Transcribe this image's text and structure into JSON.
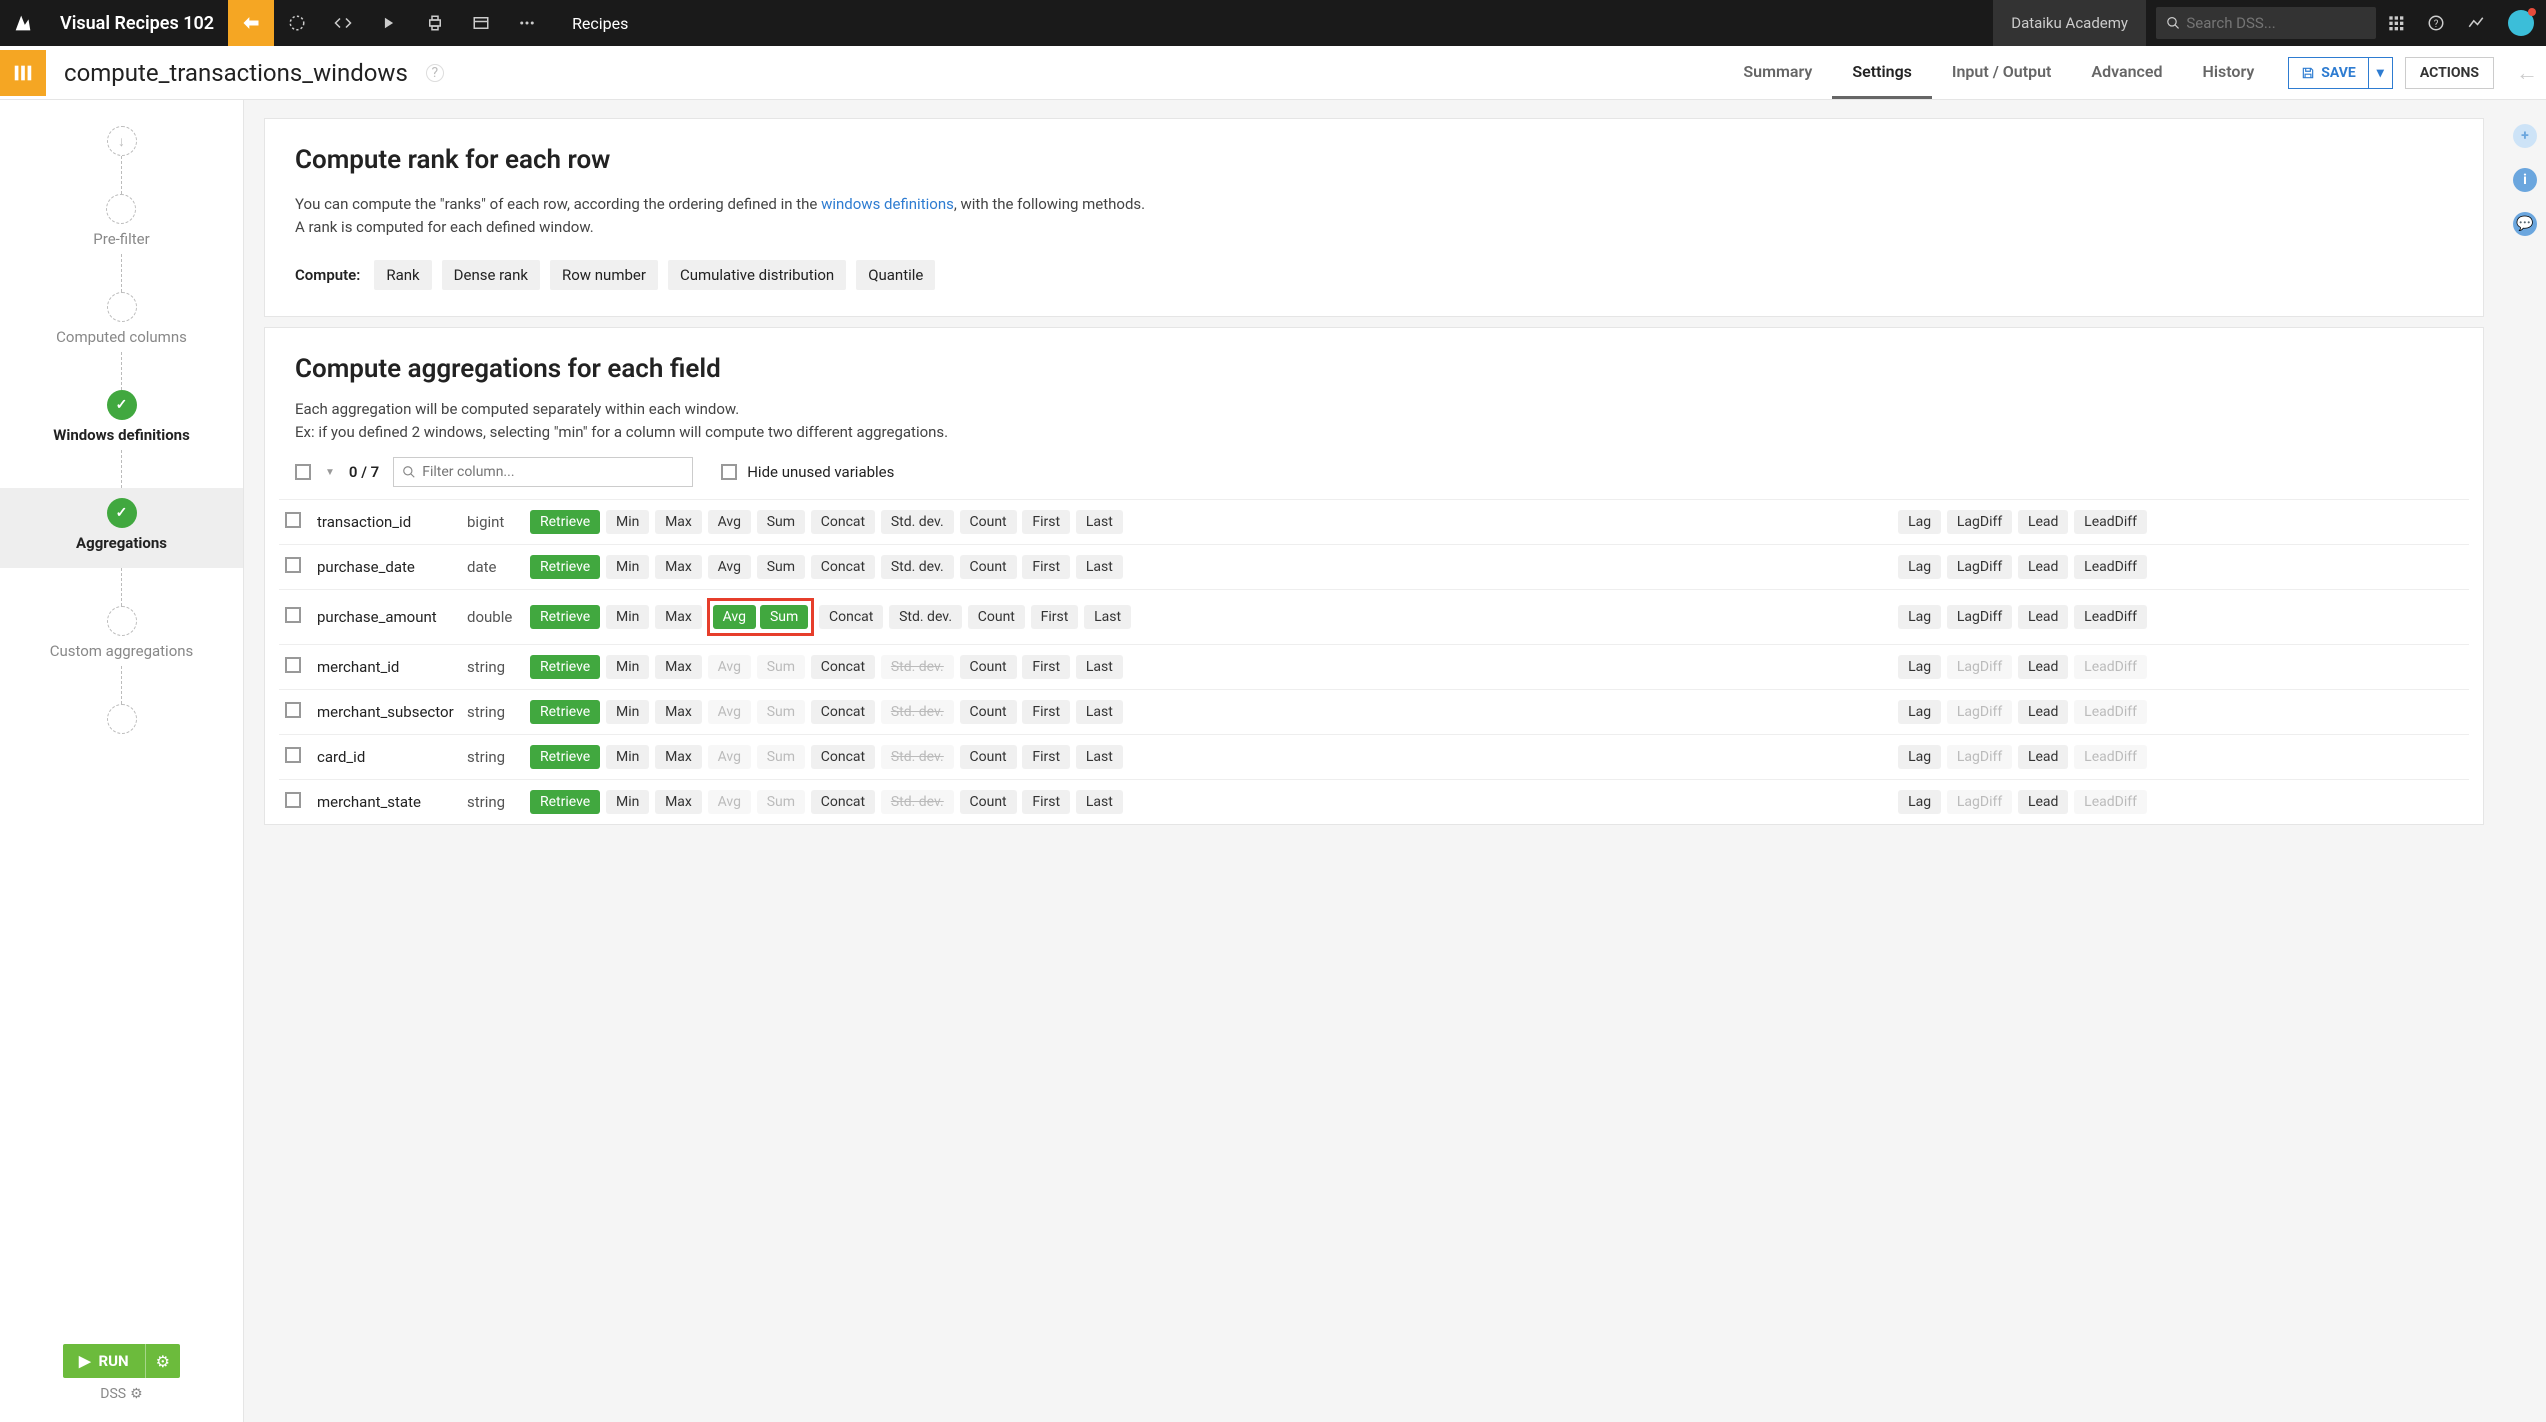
{
  "topbar": {
    "project": "Visual Recipes 102",
    "menu_label": "Recipes",
    "academy": "Dataiku Academy",
    "search_placeholder": "Search DSS..."
  },
  "subheader": {
    "title": "compute_transactions_windows",
    "tabs": [
      "Summary",
      "Settings",
      "Input / Output",
      "Advanced",
      "History"
    ],
    "active_tab": 1,
    "save": "SAVE",
    "actions": "ACTIONS"
  },
  "leftnav": {
    "steps": [
      {
        "label": "Pre-filter",
        "done": false
      },
      {
        "label": "Computed columns",
        "done": false
      },
      {
        "label": "Windows definitions",
        "done": true
      },
      {
        "label": "Aggregations",
        "done": true,
        "current": true
      },
      {
        "label": "Custom aggregations",
        "done": false
      },
      {
        "label": "",
        "done": false
      }
    ],
    "run": "RUN",
    "dss": "DSS"
  },
  "rank_card": {
    "title": "Compute rank for each row",
    "desc1a": "You can compute the \"ranks\" of each row, according the ordering defined in the ",
    "desc1b": "windows definitions",
    "desc1c": ", with the following methods.",
    "desc2": "A rank is computed for each defined window.",
    "compute_label": "Compute:",
    "chips": [
      "Rank",
      "Dense rank",
      "Row number",
      "Cumulative distribution",
      "Quantile"
    ]
  },
  "agg_card": {
    "title": "Compute aggregations for each field",
    "desc1": "Each aggregation will be computed separately within each window.",
    "desc2": "Ex: if you defined 2 windows, selecting \"min\" for a column will compute two different aggregations.",
    "counter": "0 / 7",
    "filter_placeholder": "Filter column...",
    "hide_label": "Hide unused variables",
    "agg_labels": {
      "retrieve": "Retrieve",
      "min": "Min",
      "max": "Max",
      "avg": "Avg",
      "sum": "Sum",
      "concat": "Concat",
      "stddev": "Std. dev.",
      "count": "Count",
      "first": "First",
      "last": "Last",
      "lag": "Lag",
      "lagdiff": "LagDiff",
      "lead": "Lead",
      "leaddiff": "LeadDiff"
    },
    "rows": [
      {
        "name": "transaction_id",
        "type": "bigint",
        "numeric": true,
        "highlight_avg_sum": false
      },
      {
        "name": "purchase_date",
        "type": "date",
        "numeric": true,
        "highlight_avg_sum": false
      },
      {
        "name": "purchase_amount",
        "type": "double",
        "numeric": true,
        "highlight_avg_sum": true,
        "avg_on": true,
        "sum_on": true
      },
      {
        "name": "merchant_id",
        "type": "string",
        "numeric": false
      },
      {
        "name": "merchant_subsector",
        "type": "string",
        "numeric": false
      },
      {
        "name": "card_id",
        "type": "string",
        "numeric": false
      },
      {
        "name": "merchant_state",
        "type": "string",
        "numeric": false
      }
    ]
  }
}
